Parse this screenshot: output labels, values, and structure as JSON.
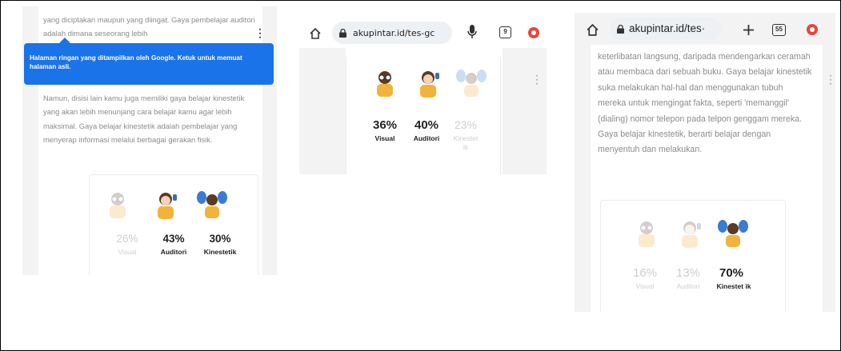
{
  "panel1": {
    "para1": "yang diciptakan maupun yang diingat. Gaya pembelajar auditori adalah dimana seseorang lebih",
    "tooltip": "Halaman ringan yang ditampilkan oleh Google. Ketuk untuk memuat halaman asli.",
    "para2": "Namun, disisi lain kamu juga memiliki gaya belajar kinestetik yang akan lebih menunjang cara belajar kamu agar lebih maksimal. Gaya belajar kinestetik adalah pembelajar yang menyerap informasi melalui berbagai gerakan fisik.",
    "results": [
      {
        "pct": "26%",
        "label": "Visual",
        "highlight": false
      },
      {
        "pct": "43%",
        "label": "Auditori",
        "highlight": true
      },
      {
        "pct": "30%",
        "label": "Kinestetik",
        "highlight": true
      }
    ]
  },
  "panel2": {
    "url": "akupintar.id/tes-gc",
    "tab_count": "9",
    "results": [
      {
        "pct": "36%",
        "label": "Visual",
        "highlight": true
      },
      {
        "pct": "40%",
        "label": "Auditori",
        "highlight": true
      },
      {
        "pct": "23%",
        "label": "Kinestet ik",
        "highlight": false
      }
    ]
  },
  "panel3": {
    "url": "akupintar.id/tes·",
    "tab_count": "55",
    "para": "keterlibatan langsung, daripada mendengarkan ceramah atau membaca dari sebuah buku. Gaya belajar kinestetik suka melakukan hal-hal dan menggunakan tubuh mereka untuk mengingat fakta, seperti 'memanggil' (dialing) nomor telepon pada telpon genggam mereka. Gaya belajar kinestetik, berarti belajar dengan menyentuh dan melakukan.",
    "results": [
      {
        "pct": "16%",
        "label": "Visual",
        "highlight": false
      },
      {
        "pct": "13%",
        "label": "Auditori",
        "highlight": false
      },
      {
        "pct": "70%",
        "label": "Kinestet ik",
        "highlight": true
      }
    ]
  },
  "colors": {
    "tooltip": "#1a73e8",
    "record": "#e8453c",
    "dim_text": "#cfcfcf",
    "body_text": "#8c8c8c"
  },
  "icons": [
    "home-icon",
    "lock-icon",
    "mic-icon",
    "tabs-icon",
    "record-icon",
    "plus-icon",
    "menu-dots-icon"
  ]
}
